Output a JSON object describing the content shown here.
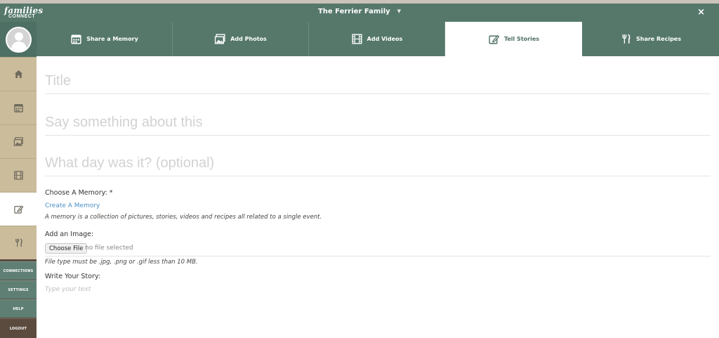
{
  "header": {
    "logo_line1": "families",
    "logo_line2": "CONNECT",
    "family_name": "The Ferrier Family",
    "close_label": "×"
  },
  "sidebar": {
    "items": [
      {
        "icon": "home-icon"
      },
      {
        "icon": "calendar-icon"
      },
      {
        "icon": "photos-icon"
      },
      {
        "icon": "film-icon"
      },
      {
        "icon": "edit-icon",
        "active": true
      },
      {
        "icon": "utensils-icon"
      }
    ],
    "links": [
      "CONNECTIONS",
      "SETTINGS",
      "HELP",
      "LOGOUT"
    ]
  },
  "tabs": [
    {
      "label": "Share a Memory",
      "icon": "calendar-icon"
    },
    {
      "label": "Add Photos",
      "icon": "photos-icon"
    },
    {
      "label": "Add Videos",
      "icon": "film-icon"
    },
    {
      "label": "Tell Stories",
      "icon": "edit-icon",
      "active": true
    },
    {
      "label": "Share Recipes",
      "icon": "utensils-icon"
    }
  ],
  "form": {
    "title_placeholder": "Title",
    "description_placeholder": "Say something about this",
    "date_placeholder": "What day was it? (optional)",
    "memory_label": "Choose A Memory: *",
    "create_memory_link": "Create A Memory",
    "memory_hint": "A memory is a collection of pictures, stories, videos and recipes all related to a single event.",
    "image_label": "Add an Image:",
    "choose_file_label": "Choose File",
    "no_file_text": "no file selected",
    "file_hint": "File type must be .jpg, .png or .gif less than 10 MB.",
    "story_label": "Write Your Story:",
    "story_placeholder": "Type your text"
  },
  "colors": {
    "header": "#55786b",
    "sidebar_tan": "#cbbd9c",
    "link": "#4a90c8"
  }
}
